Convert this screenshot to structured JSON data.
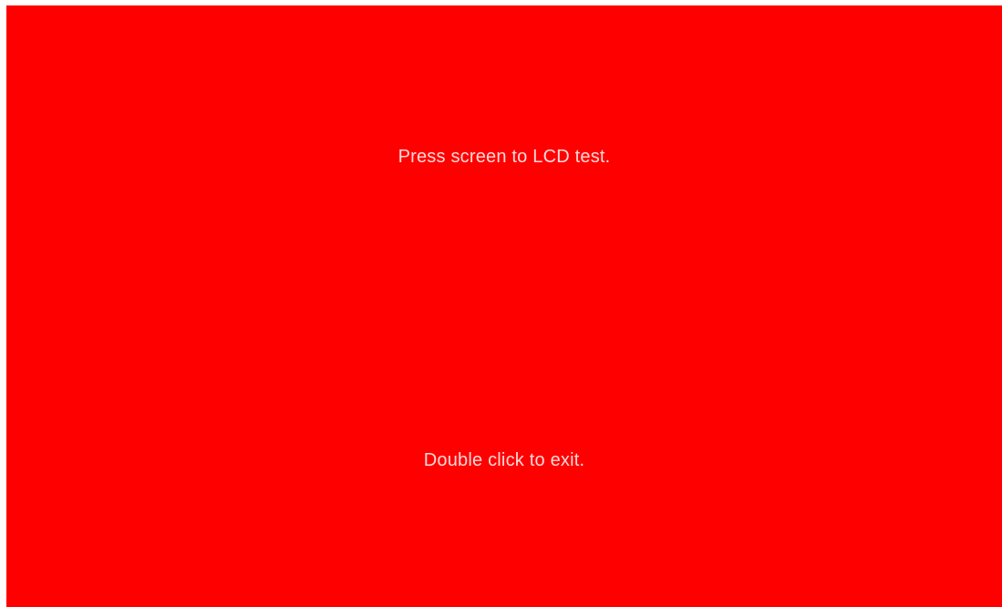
{
  "screen": {
    "background_color": "#ff0000",
    "text_color": "#ffd9d9",
    "instruction_text": "Press screen to LCD test.",
    "exit_text": "Double click to exit."
  }
}
